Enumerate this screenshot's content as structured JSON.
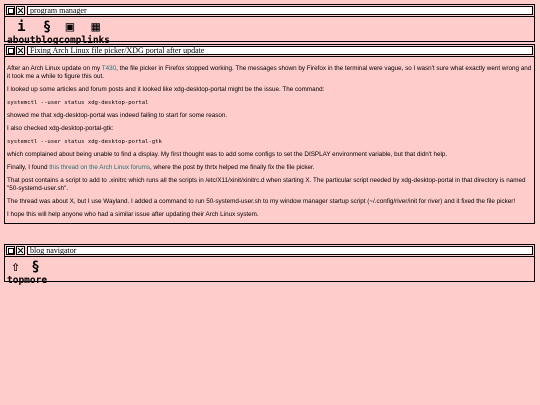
{
  "program_manager": {
    "title": "program manager",
    "items": [
      {
        "label": "about",
        "icon": "i"
      },
      {
        "label": "blog",
        "icon": "§"
      },
      {
        "label": "comp",
        "icon": "▣"
      },
      {
        "label": "links",
        "icon": "▦"
      }
    ]
  },
  "article": {
    "title": "Fixing Arch Linux file picker/XDG portal after update",
    "p1_before": "After an Arch Linux update on my ",
    "p1_link": "T430",
    "p1_after": ", the file picker in Firefox stopped working. The messages shown by Firefox in the terminal were vague, so I wasn't sure what exactly went wrong and it took me a while to figure this out.",
    "p2": "I looked up some articles and forum posts and it looked like xdg-desktop-portal might be the issue. The command:",
    "code1": "systemctl --user status xdg-desktop-portal",
    "p3": "showed me that xdg-desktop-portal was indeed failing to start for some reason.",
    "p4": "I also checked xdg-desktop-portal-gtk:",
    "code2": "systemctl --user status xdg-desktop-portal-gtk",
    "p5": "which complained about being unable to find a display. My first thought was to add some configs to set the DISPLAY environment variable, but that didn't help.",
    "p6_before": "Finally, I found ",
    "p6_link": "this thread on the Arch Linux forums",
    "p6_after": ", where the post by thrtx helped me finally fix the file picker.",
    "p7": "That post contains a script to add to .xinitrc which runs all the scripts in /etc/X11/xinit/xinitrc.d when starting X. The particular script needed by xdg-desktop-portal in that directory is named \"50-systemd-user.sh\".",
    "p8": "The thread was about X, but I use Wayland. I added a command to run 50-systemd-user.sh to my window manager startup script (~/.config/river/init for river) and it fixed the file picker!",
    "p9": "I hope this will help anyone who had a similar issue after updating their Arch Linux system."
  },
  "blog_navigator": {
    "title": "blog navigator",
    "items": [
      {
        "label": "top",
        "icon": "⇧"
      },
      {
        "label": "more",
        "icon": "§"
      }
    ]
  }
}
